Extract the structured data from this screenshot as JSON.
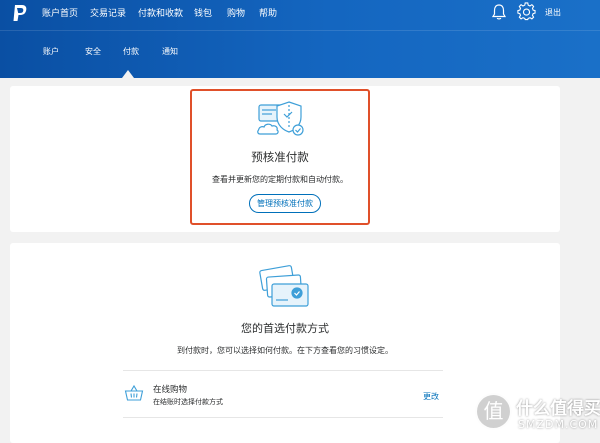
{
  "header": {
    "logo_icon": "paypal-logo-icon",
    "nav": [
      "账户首页",
      "交易记录",
      "付款和收款",
      "钱包",
      "购物",
      "帮助"
    ],
    "icons": [
      "bell-icon",
      "gear-icon"
    ],
    "logout_label": "退出"
  },
  "subnav": {
    "tabs": [
      "账户",
      "安全",
      "付款",
      "通知"
    ],
    "active_tab": "付款"
  },
  "preapproved": {
    "icon": "cloud-shield-icon",
    "title": "预核准付款",
    "description": "查看并更新您的定期付款和自动付款。",
    "button_label": "管理预核准付款"
  },
  "preferred": {
    "icon": "cards-icon",
    "title": "您的首选付款方式",
    "description": "到付款时，您可以选择如何付款。在下方查看您的习惯设定。",
    "row": {
      "icon": "shopping-basket-icon",
      "title": "在线购物",
      "subtitle": "在结账时选择付款方式",
      "action_label": "更改"
    }
  },
  "watermark": {
    "glyph": "值",
    "text_cn": "什么值得买",
    "text_en": "SMZDM.COM"
  },
  "colors": {
    "header_blue": "#0a4fa3",
    "link_blue": "#0070ba",
    "highlight_red": "#e0502a",
    "background": "#f2f2f2"
  }
}
